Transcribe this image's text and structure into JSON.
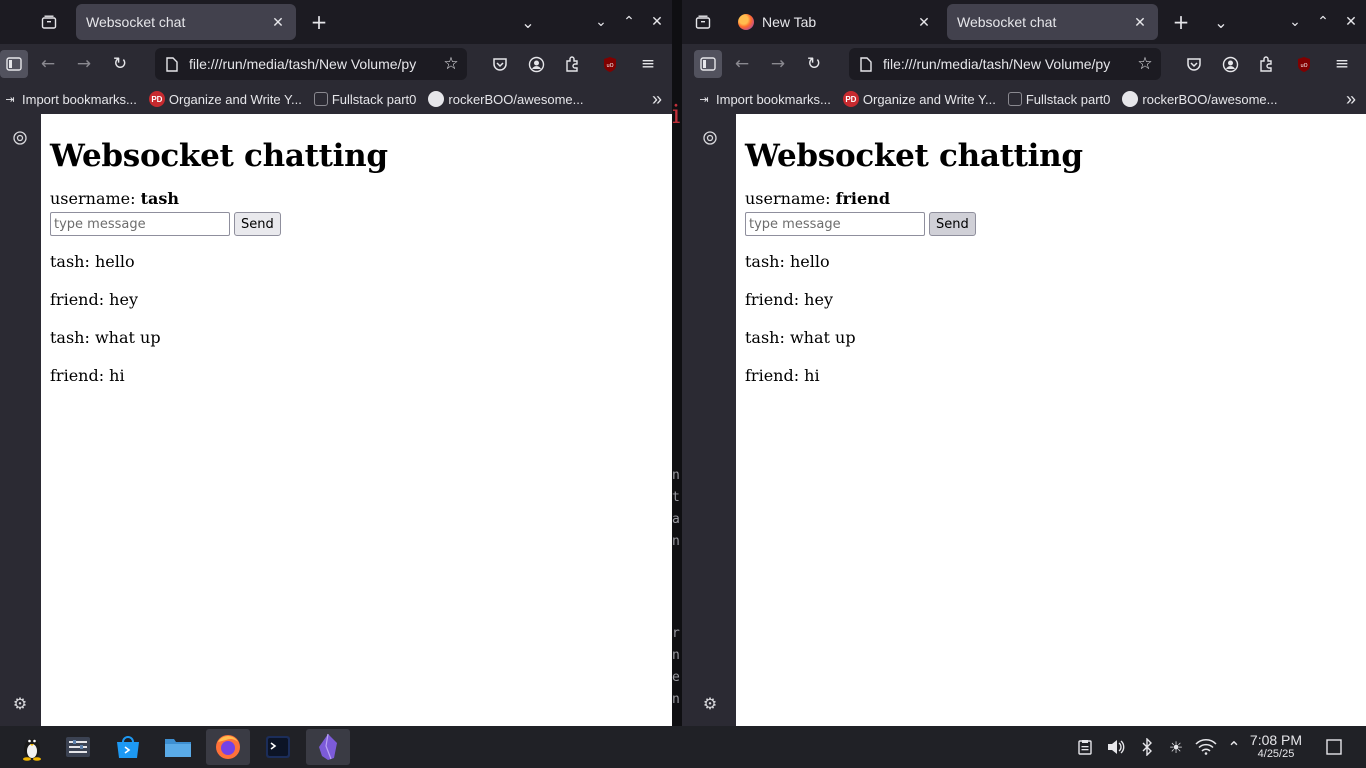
{
  "windows": [
    {
      "id": "left",
      "tabs": [
        {
          "title": "Websocket chat",
          "active": true
        }
      ],
      "url": "file:///run/media/tash/New Volume/py",
      "bookmarks": [
        "Import bookmarks...",
        "Organize and Write Y...",
        "Fullstack part0",
        "rockerBOO/awesome..."
      ],
      "page": {
        "heading": "Websocket chatting",
        "username_label": "username:",
        "username": "tash",
        "input_placeholder": "type message",
        "send_label": "Send",
        "messages": [
          "tash: hello",
          "friend: hey",
          "tash: what up",
          "friend: hi"
        ]
      }
    },
    {
      "id": "right",
      "tabs": [
        {
          "title": "New Tab",
          "active": false
        },
        {
          "title": "Websocket chat",
          "active": true
        }
      ],
      "url": "file:///run/media/tash/New Volume/py",
      "bookmarks": [
        "Import bookmarks...",
        "Organize and Write Y...",
        "Fullstack part0",
        "rockerBOO/awesome..."
      ],
      "page": {
        "heading": "Websocket chatting",
        "username_label": "username:",
        "username": "friend",
        "input_placeholder": "type message",
        "send_label": "Send",
        "messages": [
          "tash: hello",
          "friend: hey",
          "tash: what up",
          "friend: hi"
        ]
      }
    }
  ],
  "taskbar": {
    "apps": [
      "linux-tux-icon",
      "system-settings-icon",
      "app-store-icon",
      "file-manager-icon",
      "firefox-icon",
      "terminal-icon",
      "obsidian-icon"
    ],
    "clock": {
      "time": "7:08 PM",
      "date": "4/25/25"
    }
  },
  "colors": {
    "chrome_dark": "#1c1b22",
    "toolbar": "#2b2a33",
    "active_tab": "#42414d",
    "taskbar": "#202126"
  }
}
